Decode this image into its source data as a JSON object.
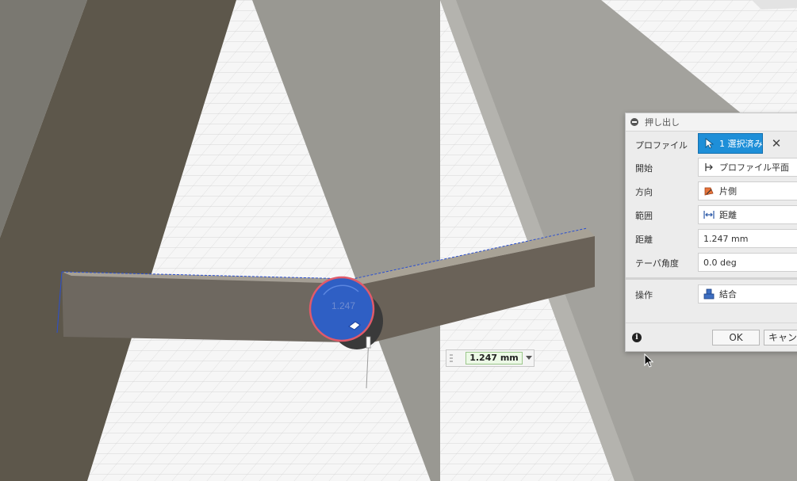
{
  "viewport": {
    "dimension_ghost_text": "1.247"
  },
  "extrude_dialog": {
    "title": "押し出し",
    "rows": {
      "profile": {
        "label": "プロファイル",
        "value": "1 選択済み",
        "icon": "cursor-select-icon",
        "clear_icon": "close-icon"
      },
      "start": {
        "label": "開始",
        "value": "プロファイル平面",
        "icon": "profile-plane-icon"
      },
      "direction": {
        "label": "方向",
        "value": "片側",
        "icon": "one-side-direction-icon"
      },
      "extent": {
        "label": "範囲",
        "value": "距離",
        "icon": "distance-extent-icon"
      },
      "distance": {
        "label": "距離",
        "value": "1.247 mm"
      },
      "taper": {
        "label": "テーパ角度",
        "value": "0.0 deg"
      },
      "operation": {
        "label": "操作",
        "value": "結合",
        "icon": "join-operation-icon"
      }
    },
    "footer": {
      "info_icon": "info-icon",
      "ok_label": "OK",
      "cancel_label": "キャンセル"
    }
  },
  "dimension_input": {
    "value": "1.247 mm"
  },
  "colors": {
    "accent": "#1e8fd8",
    "profile_fill": "#2f5fc4",
    "profile_outline": "#e05a6a",
    "edge_highlight": "#2a4fd0"
  }
}
